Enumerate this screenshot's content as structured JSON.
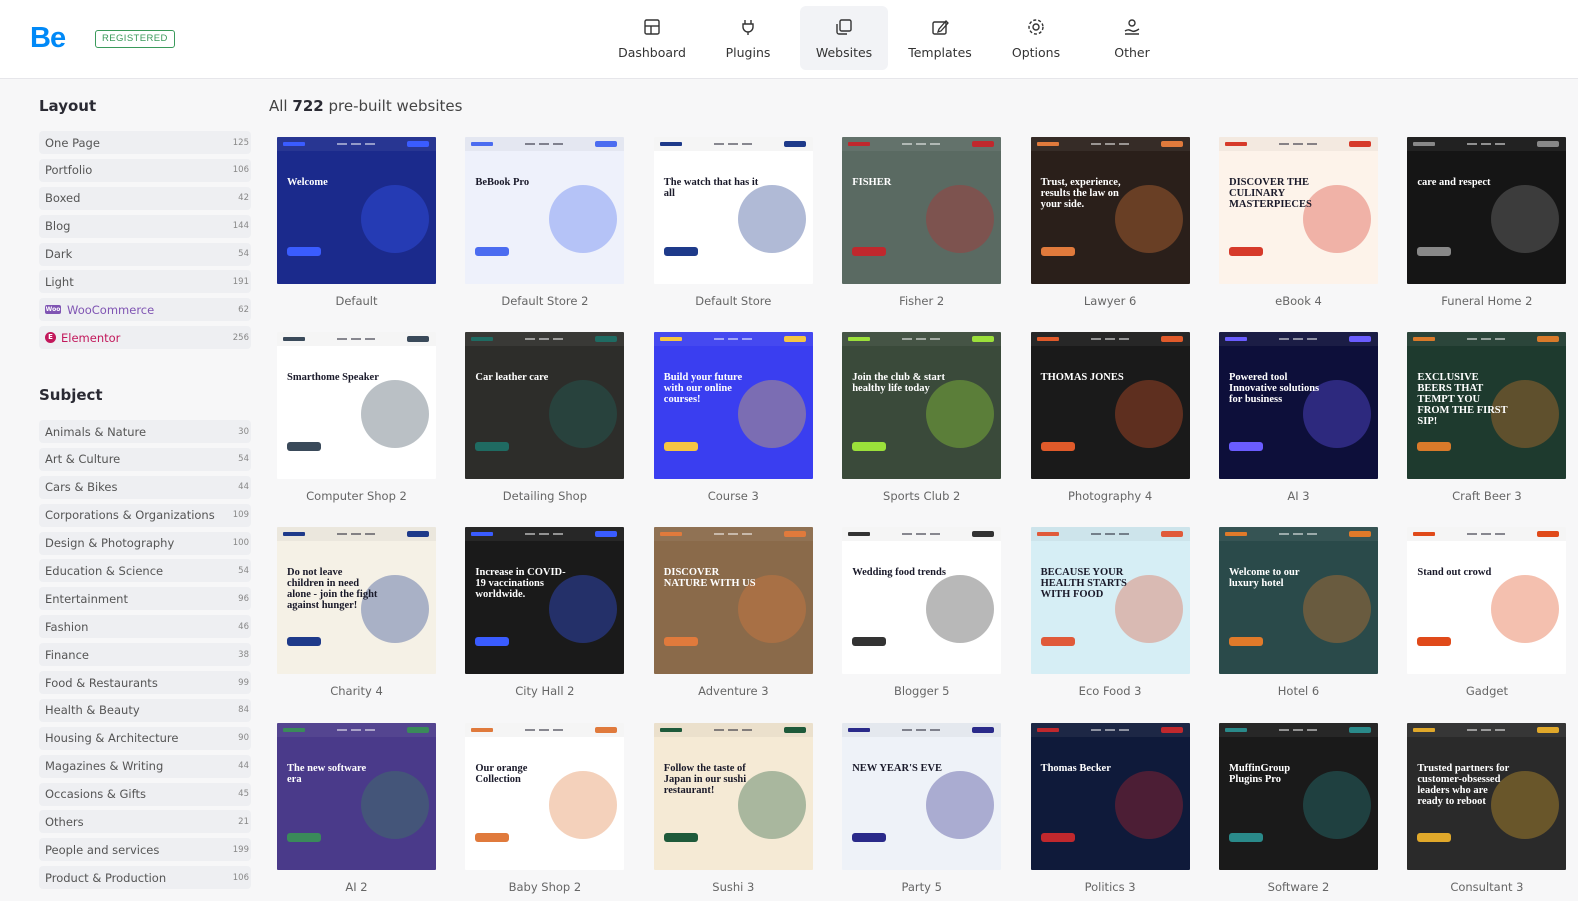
{
  "header": {
    "logo": "Be",
    "badge": "REGISTERED",
    "nav": [
      {
        "label": "Dashboard",
        "icon": "dashboard-icon"
      },
      {
        "label": "Plugins",
        "icon": "plug-icon"
      },
      {
        "label": "Websites",
        "icon": "websites-icon",
        "active": true
      },
      {
        "label": "Templates",
        "icon": "templates-icon"
      },
      {
        "label": "Options",
        "icon": "gear-icon"
      },
      {
        "label": "Other",
        "icon": "user-hand-icon"
      }
    ]
  },
  "sidebar": {
    "layout_heading": "Layout",
    "layout_items": [
      {
        "label": "One Page",
        "count": "125"
      },
      {
        "label": "Portfolio",
        "count": "106"
      },
      {
        "label": "Boxed",
        "count": "42"
      },
      {
        "label": "Blog",
        "count": "144"
      },
      {
        "label": "Dark",
        "count": "54"
      },
      {
        "label": "Light",
        "count": "191"
      },
      {
        "label": "WooCommerce",
        "count": "62",
        "badge": "woo"
      },
      {
        "label": "Elementor",
        "count": "256",
        "badge": "elem"
      }
    ],
    "subject_heading": "Subject",
    "subject_items": [
      {
        "label": "Animals & Nature",
        "count": "30"
      },
      {
        "label": "Art & Culture",
        "count": "54"
      },
      {
        "label": "Cars & Bikes",
        "count": "44"
      },
      {
        "label": "Corporations & Organizations",
        "count": "109"
      },
      {
        "label": "Design & Photography",
        "count": "100"
      },
      {
        "label": "Education & Science",
        "count": "54"
      },
      {
        "label": "Entertainment",
        "count": "96"
      },
      {
        "label": "Fashion",
        "count": "46"
      },
      {
        "label": "Finance",
        "count": "38"
      },
      {
        "label": "Food & Restaurants",
        "count": "99"
      },
      {
        "label": "Health & Beauty",
        "count": "84"
      },
      {
        "label": "Housing & Architecture",
        "count": "90"
      },
      {
        "label": "Magazines & Writing",
        "count": "44"
      },
      {
        "label": "Occasions & Gifts",
        "count": "45"
      },
      {
        "label": "Others",
        "count": "21"
      },
      {
        "label": "People and services",
        "count": "199"
      },
      {
        "label": "Product & Production",
        "count": "106"
      }
    ]
  },
  "main": {
    "title_prefix": "All",
    "title_count": "722",
    "title_suffix": "pre-built websites",
    "websites": [
      {
        "name": "Default",
        "bg": "#1b2a8c",
        "accent": "#3a5cff",
        "caption": "Welcome"
      },
      {
        "name": "Default Store 2",
        "bg": "#eef1fb",
        "accent": "#4b6cf0",
        "caption": "BeBook Pro"
      },
      {
        "name": "Default Store",
        "bg": "#ffffff",
        "accent": "#1e3a8a",
        "caption": "The watch that has it all"
      },
      {
        "name": "Fisher 2",
        "bg": "#5a6a62",
        "accent": "#c0282d",
        "caption": "FISHER"
      },
      {
        "name": "Lawyer 6",
        "bg": "#2a1f1a",
        "accent": "#e07a3c",
        "caption": "Trust, experience, results the law on your side."
      },
      {
        "name": "eBook 4",
        "bg": "#fdf3ea",
        "accent": "#d63a2a",
        "caption": "DISCOVER THE CULINARY MASTERPIECES"
      },
      {
        "name": "Funeral Home 2",
        "bg": "#151515",
        "accent": "#888888",
        "caption": "care and respect"
      },
      {
        "name": "Computer Shop 2",
        "bg": "#ffffff",
        "accent": "#3a4a5a",
        "caption": "Smarthome Speaker"
      },
      {
        "name": "Detailing Shop",
        "bg": "#2d2d2a",
        "accent": "#1f6b62",
        "caption": "Car leather care"
      },
      {
        "name": "Course 3",
        "bg": "#3a3ef0",
        "accent": "#f5c542",
        "caption": "Build your future with our online courses!"
      },
      {
        "name": "Sports Club 2",
        "bg": "#3a4a3a",
        "accent": "#9be03a",
        "caption": "Join the club & start healthy life today"
      },
      {
        "name": "Photography 4",
        "bg": "#1a1a1a",
        "accent": "#e05a2a",
        "caption": "THOMAS JONES"
      },
      {
        "name": "AI 3",
        "bg": "#0d0f3a",
        "accent": "#6a5cff",
        "caption": "Powered tool Innovative solutions for business"
      },
      {
        "name": "Craft Beer 3",
        "bg": "#1e3a2e",
        "accent": "#d97a2a",
        "caption": "EXCLUSIVE BEERS THAT TEMPT YOU FROM THE FIRST SIP!"
      },
      {
        "name": "Charity 4",
        "bg": "#f5f1e6",
        "accent": "#1e3a8a",
        "caption": "Do not leave children in need alone - join the fight against hunger!"
      },
      {
        "name": "City Hall 2",
        "bg": "#1a1a1a",
        "accent": "#3a5cff",
        "caption": "Increase in COVID-19 vaccinations worldwide."
      },
      {
        "name": "Adventure 3",
        "bg": "#8a6a4a",
        "accent": "#e07a3c",
        "caption": "DISCOVER NATURE WITH US"
      },
      {
        "name": "Blogger 5",
        "bg": "#ffffff",
        "accent": "#333333",
        "caption": "Wedding food trends"
      },
      {
        "name": "Eco Food 3",
        "bg": "#d6eef5",
        "accent": "#e05a3a",
        "caption": "BECAUSE YOUR HEALTH STARTS WITH FOOD"
      },
      {
        "name": "Hotel 6",
        "bg": "#2a4a4a",
        "accent": "#e07a2a",
        "caption": "Welcome to our luxury hotel"
      },
      {
        "name": "Gadget",
        "bg": "#ffffff",
        "accent": "#e04a1a",
        "caption": "Stand out crowd"
      },
      {
        "name": "AI 2",
        "bg": "#4a3a8a",
        "accent": "#3a8a5a",
        "caption": "The new software era"
      },
      {
        "name": "Baby Shop 2",
        "bg": "#ffffff",
        "accent": "#e07a3c",
        "caption": "Our orange Collection"
      },
      {
        "name": "Sushi 3",
        "bg": "#f5ead5",
        "accent": "#1e5a3a",
        "caption": "Follow the taste of Japan in our sushi restaurant!"
      },
      {
        "name": "Party 5",
        "bg": "#eef2f8",
        "accent": "#2a2a8a",
        "caption": "NEW YEAR'S EVE"
      },
      {
        "name": "Politics 3",
        "bg": "#0f1a3a",
        "accent": "#c0282d",
        "caption": "Thomas Becker"
      },
      {
        "name": "Software 2",
        "bg": "#1a1a1a",
        "accent": "#2a8a8a",
        "caption": "MuffinGroup Plugins Pro"
      },
      {
        "name": "Consultant 3",
        "bg": "#2a2a2a",
        "accent": "#e0a82a",
        "caption": "Trusted partners for customer-obsessed leaders who are ready to reboot"
      }
    ]
  }
}
